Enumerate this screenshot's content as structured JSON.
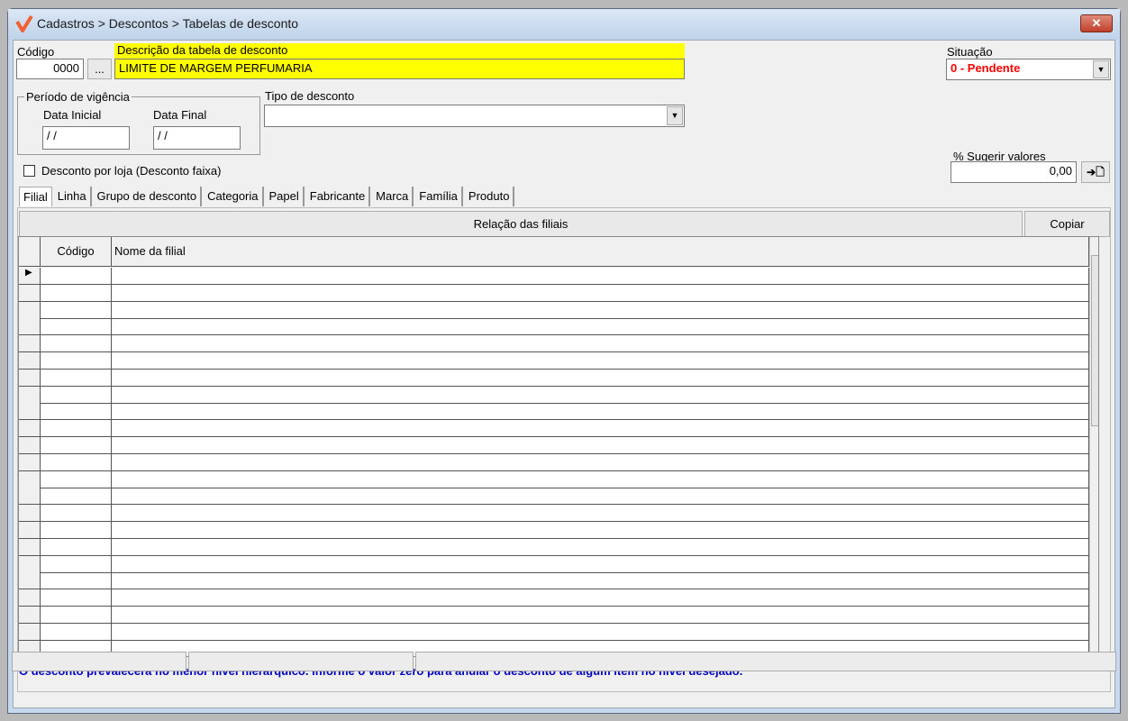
{
  "window": {
    "breadcrumb": "Cadastros > Descontos > Tabelas de desconto",
    "close": "✕"
  },
  "form": {
    "codigo_label": "Código",
    "codigo_value": "0000",
    "lookup_button": "...",
    "descricao_label": "Descrição da tabela de desconto",
    "descricao_value": "LIMITE DE MARGEM PERFUMARIA",
    "situacao_label": "Situação",
    "situacao_value": "0 - Pendente",
    "periodo_label": "Período de vigência",
    "data_inicial_label": "Data Inicial",
    "data_inicial_value": " / /",
    "data_final_label": "Data Final",
    "data_final_value": " / /",
    "tipo_label": "Tipo de desconto",
    "tipo_value": "",
    "desconto_loja_label": "Desconto por loja (Desconto faixa)",
    "sugerir_label": "% Sugerir valores",
    "sugerir_value": "0,00",
    "sugerir_button": "➔🗋"
  },
  "tabs": [
    "Filial",
    "Linha",
    "Grupo de desconto",
    "Categoria",
    "Papel",
    "Fabricante",
    "Marca",
    "Família",
    "Produto"
  ],
  "panel": {
    "title": "Relação das filiais",
    "copy_button": "Copiar",
    "columns": [
      "Código",
      "Nome da filial"
    ],
    "row_count": 23
  },
  "footer_note": "O desconto prevalecerá no menor nível hierarquico. Informe o valor zero para anular o desconto de algum item no nível desejado.",
  "colors": {
    "accent_red": "#ff0000",
    "highlight_yellow": "#ffff00",
    "note_blue": "#0000c0"
  }
}
